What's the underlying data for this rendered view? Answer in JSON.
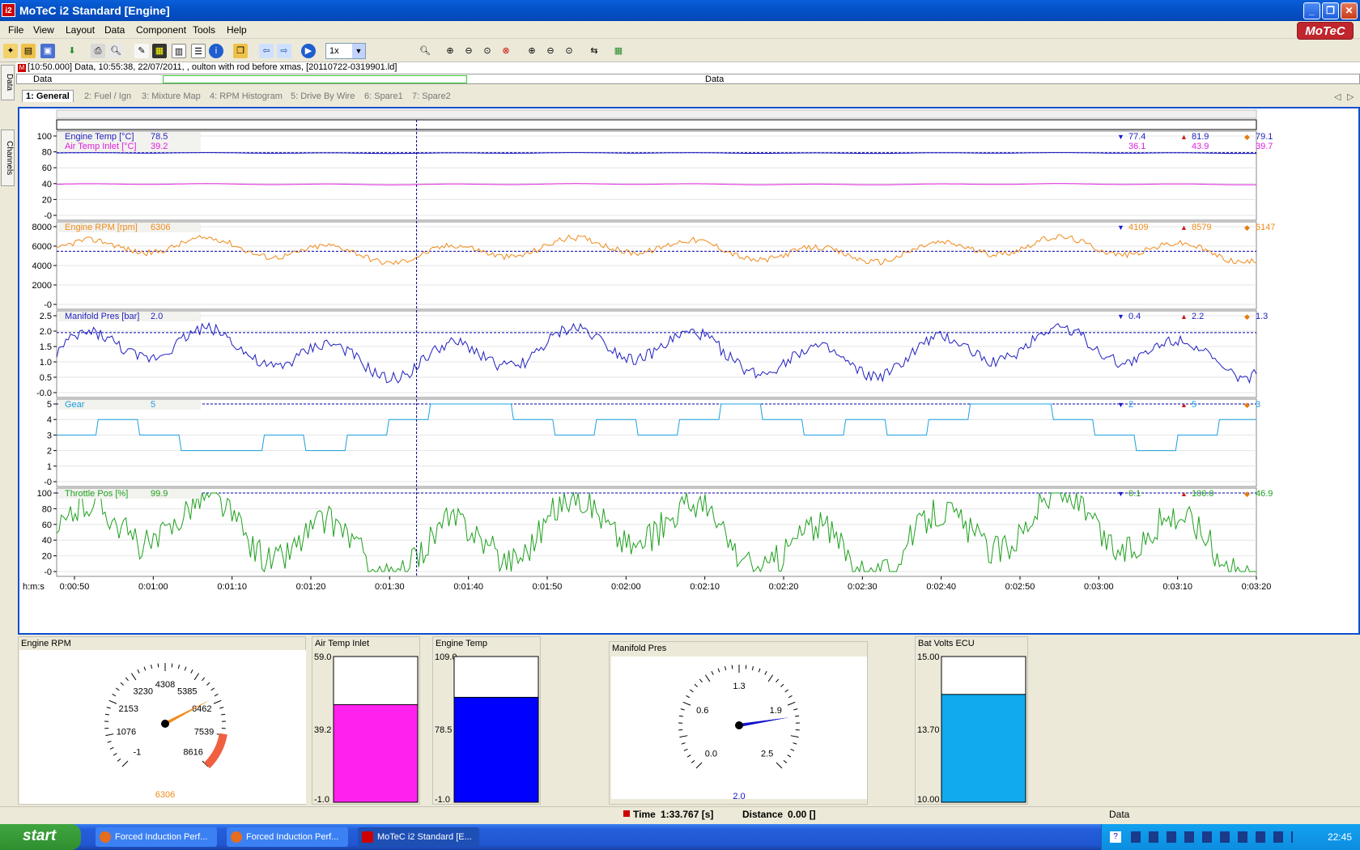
{
  "window": {
    "title": "MoTeC i2 Standard [Engine]",
    "icon": "i2"
  },
  "menu": [
    "File",
    "View",
    "Layout",
    "Data",
    "Component",
    "Tools",
    "Help"
  ],
  "logo": "MoTeC",
  "toolbar": {
    "zoom_value": "1x"
  },
  "side_tabs": [
    "Data",
    "Channels"
  ],
  "info": {
    "marker": "M",
    "text": "[10:50.000] Data, 10:55:38, 22/07/2011, , oulton with rod before xmas,  [20110722-0319901.ld]"
  },
  "range": {
    "left_label": "Data",
    "center_label": "Data"
  },
  "worksheet_tabs": [
    "1: General",
    "2: Fuel / Ign",
    "3: Mixture Map",
    "4: RPM Histogram",
    "5: Drive By Wire",
    "6: Spare1",
    "7: Spare2"
  ],
  "cursor_time_fraction": 0.3,
  "graphs": [
    {
      "id": "temps",
      "ticks": [
        "100",
        "80",
        "60",
        "40",
        "20",
        "-0"
      ],
      "ymin": 0,
      "ymax": 100,
      "channels": [
        {
          "name": "Engine Temp [°C]",
          "value": "78.5",
          "color": "#1f1fc0",
          "min": "77.4",
          "max": "81.9",
          "avg": "79.1",
          "base": 78.5,
          "amp": 0.6,
          "spike": 0,
          "step": false
        },
        {
          "name": "Air Temp Inlet [°C]",
          "value": "39.2",
          "color": "#e020e0",
          "min": "36.1",
          "max": "43.9",
          "avg": "39.7",
          "base": 39.2,
          "amp": 0.8,
          "spike": 0,
          "step": false
        }
      ],
      "avgline": [
        79,
        39
      ]
    },
    {
      "id": "rpm",
      "ticks": [
        "8000",
        "6000",
        "4000",
        "2000",
        "-0"
      ],
      "ymin": 0,
      "ymax": 9000,
      "channels": [
        {
          "name": "Engine RPM [rpm]",
          "value": "6306",
          "color": "#f08a1a",
          "min": "4109",
          "max": "8579",
          "avg": "6147",
          "base": 6300,
          "amp": 1500,
          "spike": 700,
          "step": false
        }
      ],
      "avgline": [
        6147
      ]
    },
    {
      "id": "map",
      "ticks": [
        "2.5",
        "2.0",
        "1.5",
        "1.0",
        "0.5",
        "-0.0"
      ],
      "ymin": 0,
      "ymax": 2.5,
      "channels": [
        {
          "name": "Manifold Pres [bar]",
          "value": "2.0",
          "color": "#1f1fc0",
          "min": "0.4",
          "max": "2.2",
          "avg": "1.3",
          "base": 1.3,
          "amp": 0.85,
          "spike": 0.4,
          "step": false
        }
      ],
      "avgline": [
        1.95
      ]
    },
    {
      "id": "gear",
      "ticks": [
        "5",
        "4",
        "3",
        "2",
        "1",
        "-0"
      ],
      "ymin": 0,
      "ymax": 5,
      "channels": [
        {
          "name": "Gear",
          "value": "5",
          "color": "#1aa0e0",
          "min": "2",
          "max": "5",
          "avg": "3",
          "base": 3,
          "amp": 1,
          "spike": 0,
          "step": true
        }
      ],
      "avgline": [
        5
      ]
    },
    {
      "id": "tps",
      "ticks": [
        "100",
        "80",
        "60",
        "40",
        "20",
        "-0"
      ],
      "ymin": 0,
      "ymax": 100,
      "channels": [
        {
          "name": "Throttle Pos [%]",
          "value": "99.9",
          "color": "#1ea01e",
          "min": "0.1",
          "max": "100.0",
          "avg": "46.9",
          "base": 45,
          "amp": 55,
          "spike": 40,
          "step": false
        }
      ],
      "avgline": [
        100
      ]
    }
  ],
  "time_axis": {
    "label": "h:m:s",
    "ticks": [
      "0:00:50",
      "0:01:00",
      "0:01:10",
      "0:01:20",
      "0:01:30",
      "0:01:40",
      "0:01:50",
      "0:02:00",
      "0:02:10",
      "0:02:20",
      "0:02:30",
      "0:02:40",
      "0:02:50",
      "0:03:00",
      "0:03:10",
      "0:03:20"
    ]
  },
  "gauges": {
    "rpm": {
      "title": "Engine RPM",
      "labels": [
        "-1",
        "1076",
        "2153",
        "3230",
        "4308",
        "5385",
        "6462",
        "7539",
        "8616"
      ],
      "value": "6306",
      "value_fraction": 0.73
    },
    "air_temp": {
      "title": "Air Temp Inlet",
      "top": "59.0",
      "mid": "39.2",
      "bottom": "-1.0",
      "fill_fraction": 0.67,
      "color": "#ff22ee"
    },
    "eng_temp": {
      "title": "Engine Temp",
      "top": "109.0",
      "mid": "78.5",
      "bottom": "-1.0",
      "fill_fraction": 0.72,
      "color": "#0000ff"
    },
    "map": {
      "title": "Manifold Pres",
      "labels": [
        "0.0",
        "0.6",
        "1.3",
        "1.9",
        "2.5"
      ],
      "value": "2.0",
      "value_fraction": 0.8
    },
    "batt": {
      "title": "Bat Volts ECU",
      "top": "15.00",
      "mid": "13.70",
      "bottom": "10.00",
      "fill_fraction": 0.74,
      "color": "#11aaee"
    }
  },
  "status": {
    "time_label": "Time",
    "time_value": "1:33.767 [s]",
    "distance_label": "Distance",
    "distance_value": "0.00 []",
    "right": "Data"
  },
  "taskbar": {
    "start": "start",
    "tasks": [
      "Forced Induction Perf...",
      "Forced Induction Perf...",
      "MoTeC i2 Standard [E..."
    ],
    "clock": "22:45"
  }
}
